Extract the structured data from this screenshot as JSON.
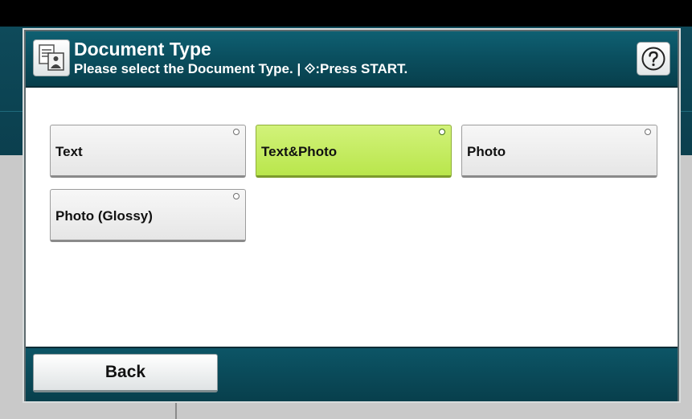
{
  "dialog": {
    "title": "Document Type",
    "subtitle": "Please select the Document Type. | ⟐:Press START.",
    "icon": "document-copy-icon",
    "help_icon": "question-mark-icon"
  },
  "options": [
    {
      "label": "Text",
      "selected": false
    },
    {
      "label": "Text&Photo",
      "selected": true
    },
    {
      "label": "Photo",
      "selected": false
    },
    {
      "label": "Photo (Glossy)",
      "selected": false
    }
  ],
  "footer": {
    "back_label": "Back"
  },
  "colors": {
    "header": "#0a4e5e",
    "selected": "#c3ec5e",
    "option": "#eeeeee"
  }
}
